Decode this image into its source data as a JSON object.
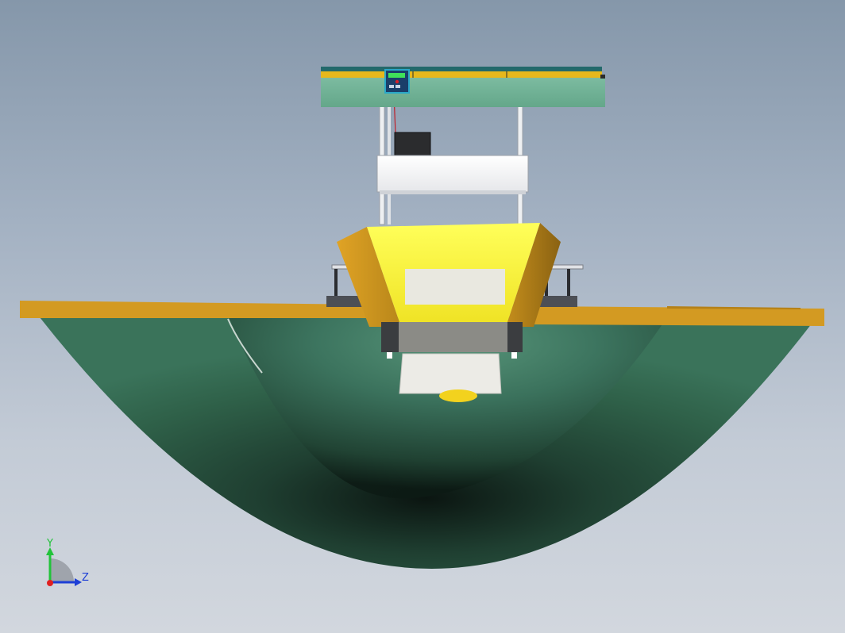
{
  "viewport": {
    "background_top": "#8597aa",
    "background_bottom": "#d2d7de"
  },
  "model": {
    "hull_color": "#2c5a44",
    "deck_color": "#d39a22",
    "hopper_color": "#f2ea2a",
    "canopy_color": "#6aae92",
    "canopy_strip_color": "#e6b81c",
    "panel_color": "#e9e8e0"
  },
  "triad": {
    "y_label": "Y",
    "z_label": "Z",
    "y_color": "#22c33a",
    "z_color": "#1d3fd6",
    "origin_color": "#e02020"
  }
}
